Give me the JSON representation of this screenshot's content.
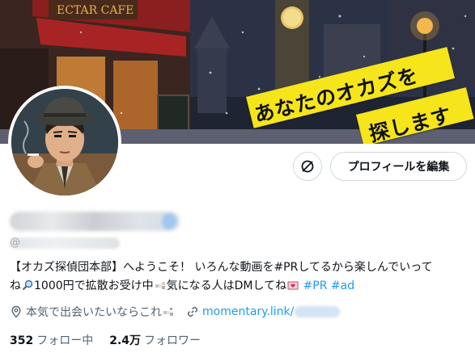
{
  "banner": {
    "caption_line1": "あなたのオカズを",
    "caption_line2": "探します"
  },
  "actions": {
    "edit_profile_label": "プロフィールを編集"
  },
  "profile": {
    "handle_prefix": "@"
  },
  "bio": {
    "line1": "【オカズ探偵団本部】へようこそ！ いろんな動画を#PRしてるから楽しんでいって",
    "line2_a": "ね",
    "line2_b": "1000円で拡散お受け中",
    "line2_c": "気になる人はDMしてね",
    "hashtag_pr": "#PR",
    "hashtag_ad": "#ad"
  },
  "meta": {
    "location": "本気で出会いたいならこれ",
    "link": "momentary.link/"
  },
  "stats": {
    "following_count": "352",
    "following_label": "フォロー中",
    "followers_count": "2.4万",
    "followers_label": "フォロワー"
  }
}
